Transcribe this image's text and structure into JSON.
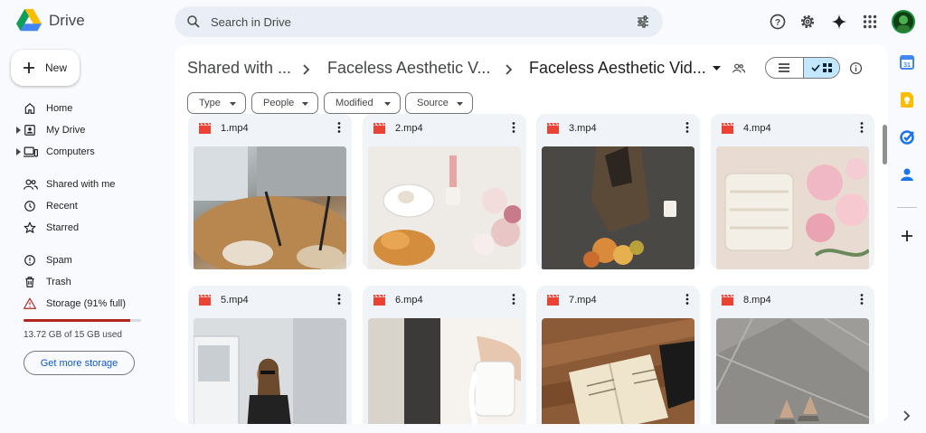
{
  "app": {
    "title": "Drive"
  },
  "search": {
    "placeholder": "Search in Drive"
  },
  "header_icons": [
    "help-icon",
    "settings-icon",
    "gemini-icon",
    "apps-icon",
    "avatar"
  ],
  "sidebar": {
    "new_label": "New",
    "items": [
      {
        "label": "Home",
        "icon": "home-icon"
      },
      {
        "label": "My Drive",
        "icon": "my-drive-icon"
      },
      {
        "label": "Computers",
        "icon": "computers-icon"
      },
      {
        "label": "Shared with me",
        "icon": "shared-icon"
      },
      {
        "label": "Recent",
        "icon": "clock-icon"
      },
      {
        "label": "Starred",
        "icon": "star-icon"
      },
      {
        "label": "Spam",
        "icon": "spam-icon"
      },
      {
        "label": "Trash",
        "icon": "trash-icon"
      },
      {
        "label": "Storage (91% full)",
        "icon": "warning-icon"
      }
    ],
    "storage": {
      "used_text": "13.72 GB of 15 GB used",
      "fraction": 0.91,
      "button_label": "Get more storage"
    }
  },
  "breadcrumb": [
    "Shared with ...",
    "Faceless Aesthetic V...",
    "Faceless Aesthetic Vid..."
  ],
  "filters": [
    "Type",
    "People",
    "Modified",
    "Source"
  ],
  "files": [
    {
      "name": "1.mp4"
    },
    {
      "name": "2.mp4"
    },
    {
      "name": "3.mp4"
    },
    {
      "name": "4.mp4"
    },
    {
      "name": "5.mp4"
    },
    {
      "name": "6.mp4"
    },
    {
      "name": "7.mp4"
    },
    {
      "name": "8.mp4"
    }
  ],
  "right_panel_icons": [
    "calendar-icon",
    "keep-icon",
    "tasks-icon",
    "contacts-icon",
    "add-icon",
    "expand-icon"
  ],
  "colors": {
    "accent": "#0b57d0",
    "storage_warning": "#b3261e",
    "video_red": "#ea4335",
    "selected_view": "#c2e7ff"
  }
}
